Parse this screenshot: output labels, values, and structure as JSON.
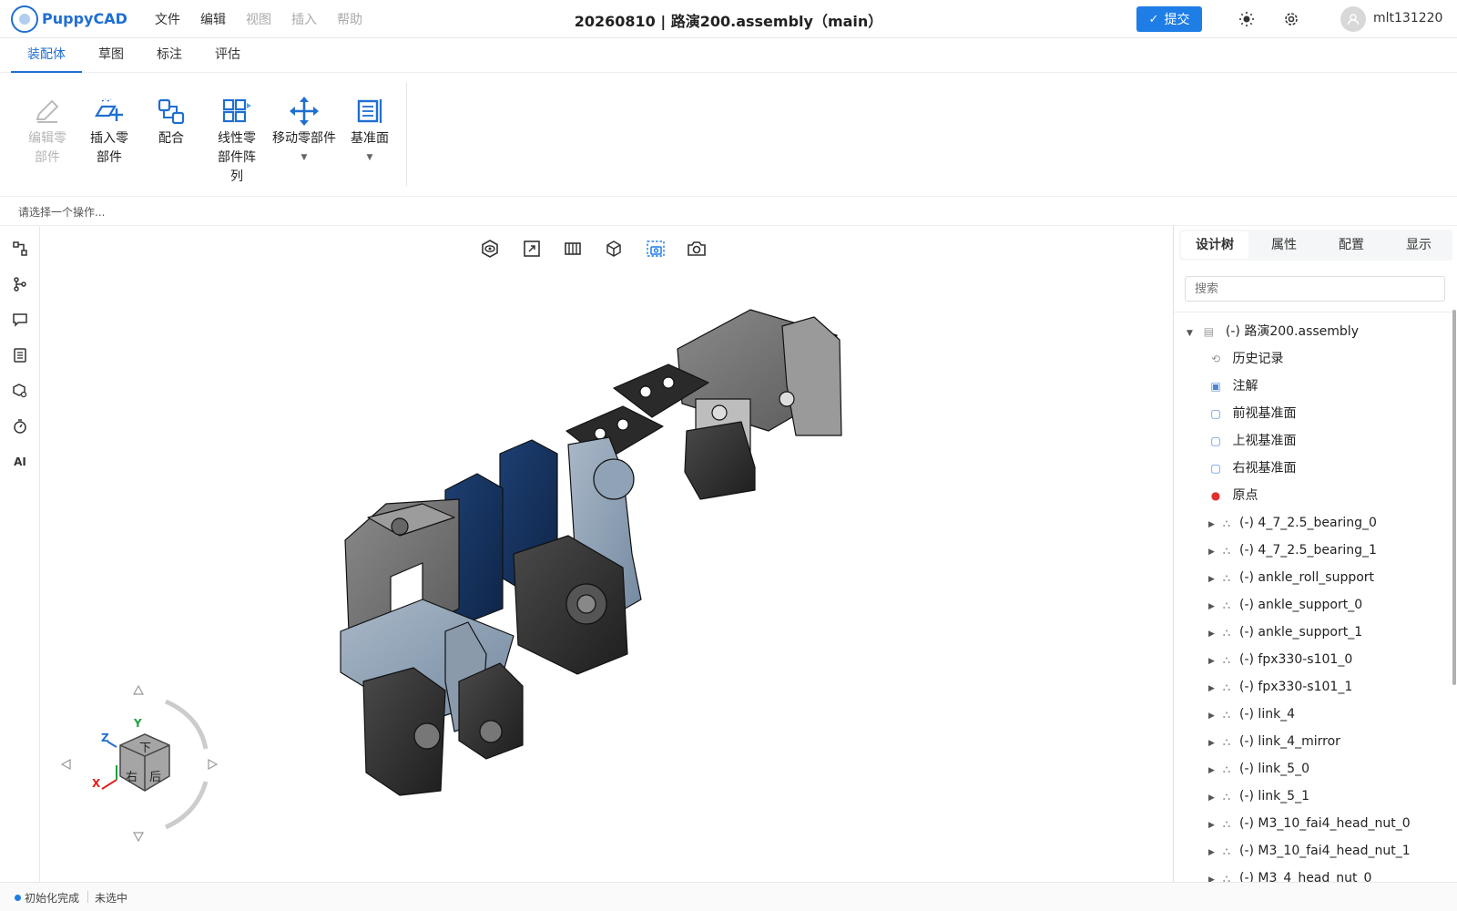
{
  "app": {
    "name": "PuppyCAD"
  },
  "menu": [
    {
      "label": "文件",
      "disabled": false
    },
    {
      "label": "编辑",
      "disabled": false
    },
    {
      "label": "视图",
      "disabled": true
    },
    {
      "label": "插入",
      "disabled": true
    },
    {
      "label": "帮助",
      "disabled": true
    }
  ],
  "document": {
    "title": "20260810 | 路演200.assembly（main）"
  },
  "header": {
    "submit_label": "提交",
    "username": "mlt131220",
    "accent": "#1f7de6"
  },
  "ribbon_tabs": [
    "装配体",
    "草图",
    "标注",
    "评估"
  ],
  "tools": {
    "edit_part": "编辑零部件",
    "insert_part": "插入零部件",
    "mate": "配合",
    "linear_pattern": "线性零部件阵列",
    "move_part": "移动零部件",
    "datum_plane": "基准面"
  },
  "hint": "请选择一个操作...",
  "rail": {
    "ai": "AI"
  },
  "panel": {
    "tabs": [
      "设计树",
      "属性",
      "配置",
      "显示"
    ],
    "search_placeholder": "搜索"
  },
  "tree": {
    "root": "(-) 路演200.assembly",
    "features": [
      "历史记录",
      "注解",
      "前视基准面",
      "上视基准面",
      "右视基准面",
      "原点"
    ],
    "parts": [
      "(-) 4_7_2.5_bearing_0",
      "(-) 4_7_2.5_bearing_1",
      "(-) ankle_roll_support",
      "(-) ankle_support_0",
      "(-) ankle_support_1",
      "(-) fpx330-s101_0",
      "(-) fpx330-s101_1",
      "(-) link_4",
      "(-) link_4_mirror",
      "(-) link_5_0",
      "(-) link_5_1",
      "(-) M3_10_fai4_head_nut_0",
      "(-) M3_10_fai4_head_nut_1",
      "(-) M3_4_head_nut_0"
    ]
  },
  "viewcube": {
    "axis_x": "X",
    "axis_y": "Y",
    "axis_z": "Z",
    "face_top": "下",
    "face_right": "右",
    "face_back": "后"
  },
  "status": {
    "state": "初始化完成",
    "selection": "未选中"
  }
}
